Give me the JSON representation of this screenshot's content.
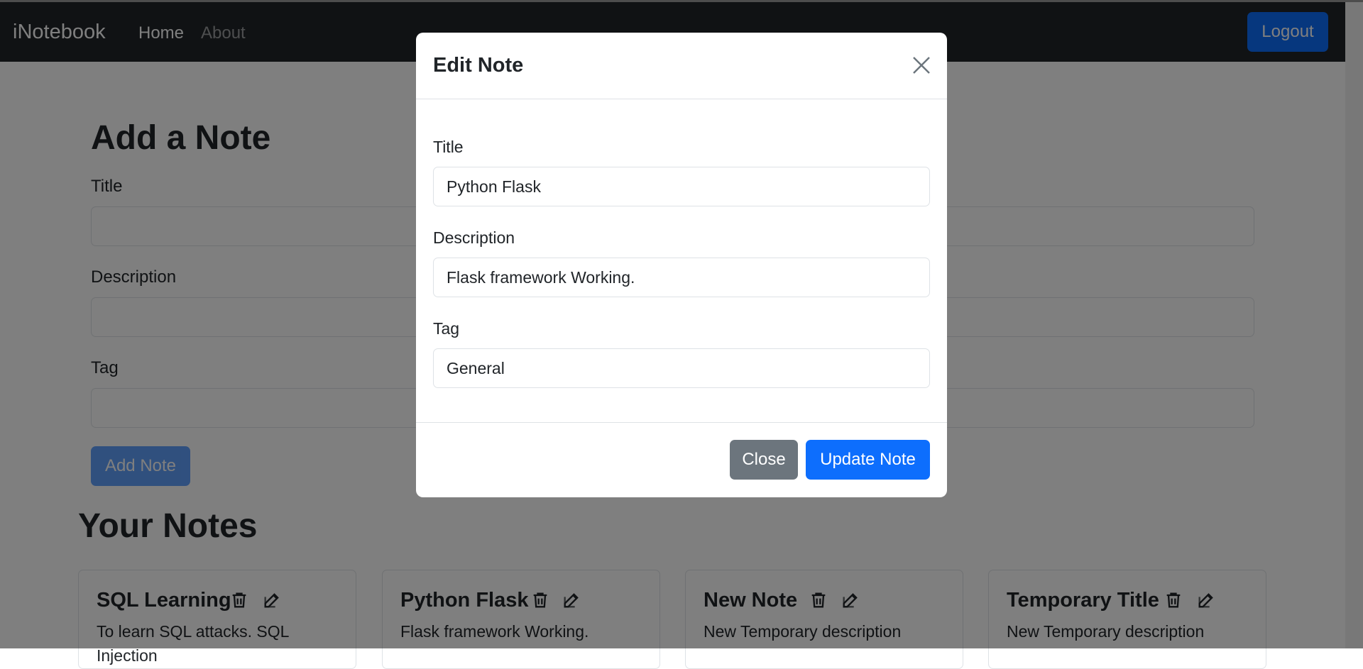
{
  "navbar": {
    "brand": "iNotebook",
    "links": [
      {
        "label": "Home"
      },
      {
        "label": "About"
      }
    ],
    "logout_label": "Logout"
  },
  "add_form": {
    "heading": "Add a Note",
    "title_label": "Title",
    "description_label": "Description",
    "tag_label": "Tag",
    "submit_label": "Add Note"
  },
  "notes_heading": "Your Notes",
  "notes": [
    {
      "title": "SQL Learning",
      "description": "To learn SQL attacks. SQL Injection"
    },
    {
      "title": "Python Flask",
      "description": "Flask framework Working."
    },
    {
      "title": "New Note",
      "description": "New Temporary description"
    },
    {
      "title": "Temporary Title",
      "description": "New Temporary description"
    }
  ],
  "modal": {
    "title": "Edit Note",
    "title_label": "Title",
    "title_value": "Python Flask",
    "description_label": "Description",
    "description_value": "Flask framework Working.",
    "tag_label": "Tag",
    "tag_value": "General",
    "close_label": "Close",
    "update_label": "Update Note"
  },
  "colors": {
    "primary": "#0d6efd",
    "secondary": "#6c757d",
    "navbar": "#212529"
  }
}
